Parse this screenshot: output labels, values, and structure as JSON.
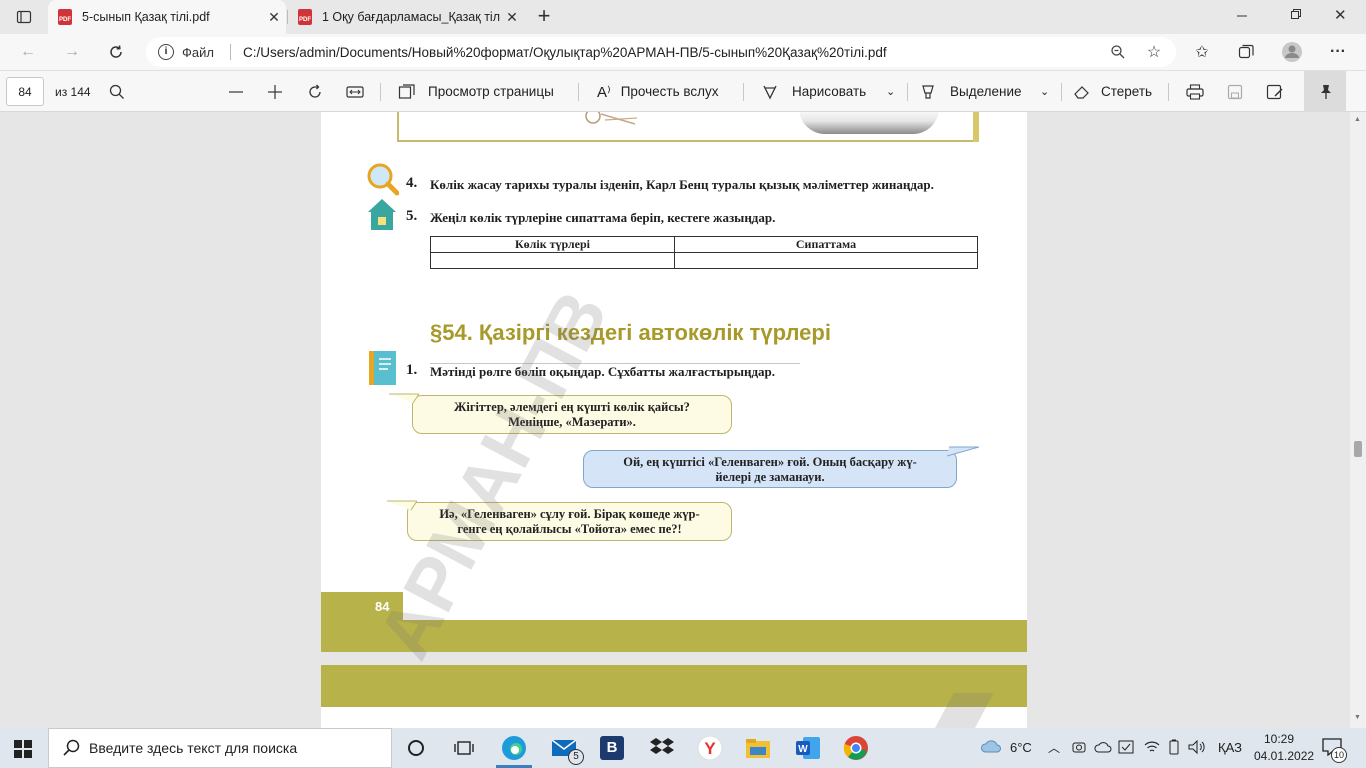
{
  "tabs": [
    {
      "label": "5-сынып Қазақ тілі.pdf",
      "active": true
    },
    {
      "label": "1 Оқу бағдарламасы_Қазақ тілі",
      "active": false
    }
  ],
  "address": {
    "site_label": "Файл",
    "url": "C:/Users/admin/Documents/Новый%20формат/Оқулықтар%20АРМАН-ПВ/5-сынып%20Қазақ%20тілі.pdf"
  },
  "pdf_toolbar": {
    "page_number": "84",
    "page_total": "из 144",
    "page_view": "Просмотр страницы",
    "read_aloud": "Прочесть вслух",
    "draw": "Нарисовать",
    "highlight": "Выделение",
    "erase": "Стереть"
  },
  "document": {
    "task4_num": "4.",
    "task4_text": "Көлік жасау тарихы туралы ізденіп, Карл Бенц туралы қызық мәліметтер жинаңдар.",
    "task5_num": "5.",
    "task5_text": "Жеңіл көлік түрлеріне сипаттама беріп, кестеге жазыңдар.",
    "table_headers": [
      "Көлік түрлері",
      "Сипаттама"
    ],
    "section_title": "§54. Қазіргі кездегі автокөлік түрлері",
    "task1_num": "1.",
    "task1_text": "Мәтінді рөлге бөліп оқыңдар. Сұхбатты жалғастырыңдар.",
    "bubble1_line1": "Жігіттер, әлемдегі ең күшті көлік қайсы?",
    "bubble1_line2": "Меніңше, «Мазерати».",
    "bubble2_line1": "Ой, ең күштісі «Геленваген» ғой. Оның басқару жү-",
    "bubble2_line2": "йелері де заманауи.",
    "bubble3_line1": "Иә, «Геленваген» сұлу ғой. Бірақ көшеде жүр-",
    "bubble3_line2": "генге ең қолайлысы «Тойота» емес  пе?!",
    "page_number": "84",
    "watermark": "АРМАН-ПВ"
  },
  "taskbar": {
    "search_placeholder": "Введите здесь текст для поиска",
    "mail_badge": "5",
    "weather": "6°C",
    "language": "ҚАЗ",
    "time": "10:29",
    "date": "04.01.2022",
    "notification_count": "10"
  },
  "colors": {
    "olive": "#b8b24a",
    "section_title": "#a79a2a",
    "bubble_yellow": "#fdfbe3",
    "bubble_blue": "#d5e5f7",
    "teal_icon": "#3aa6a0"
  }
}
